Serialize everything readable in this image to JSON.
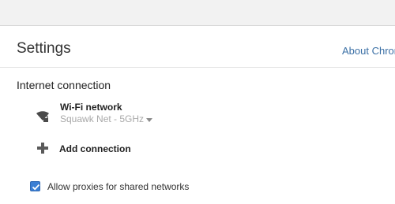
{
  "header": {
    "title": "Settings",
    "about_link": "About Chrome OS"
  },
  "internet": {
    "heading": "Internet connection",
    "network": {
      "name": "Wi-Fi network",
      "status": "Squawk Net - 5GHz",
      "icon": "wifi-locked-icon"
    },
    "add_connection": {
      "label": "Add connection",
      "icon": "plus-icon"
    }
  },
  "proxies": {
    "label": "Allow proxies for shared networks",
    "checked": true
  },
  "colors": {
    "accent": "#3b7fd4",
    "link": "#3a6fa5"
  }
}
